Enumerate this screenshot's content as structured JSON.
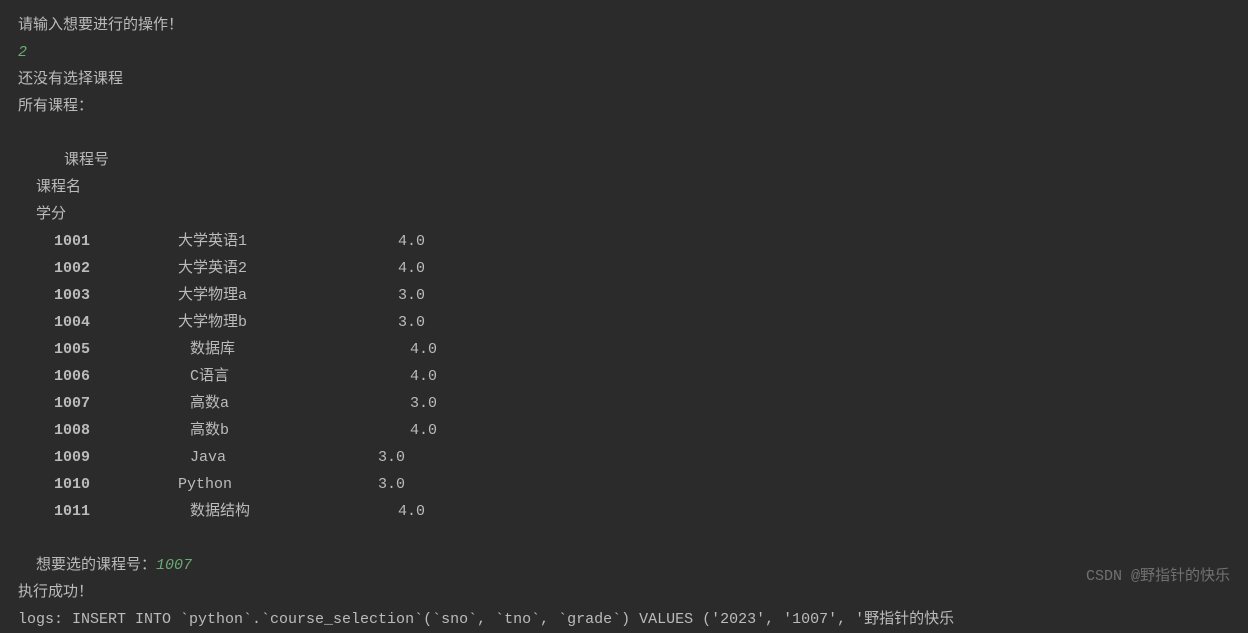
{
  "prompt_operation": "请输入想要进行的操作！",
  "operation_input": "2",
  "no_selection": "还没有选择课程",
  "all_courses_label": "所有课程：",
  "headers": {
    "course_id": "课程号",
    "course_name": "课程名",
    "credit": "学分"
  },
  "courses": [
    {
      "id": "1001",
      "name": "大学英语1",
      "credit": "4.0",
      "indent_name": 0,
      "indent_credit": 0
    },
    {
      "id": "1002",
      "name": "大学英语2",
      "credit": "4.0",
      "indent_name": 0,
      "indent_credit": 0
    },
    {
      "id": "1003",
      "name": "大学物理a",
      "credit": "3.0",
      "indent_name": 0,
      "indent_credit": 0
    },
    {
      "id": "1004",
      "name": "大学物理b",
      "credit": "3.0",
      "indent_name": 0,
      "indent_credit": 0
    },
    {
      "id": "1005",
      "name": "数据库",
      "credit": "4.0",
      "indent_name": 1,
      "indent_credit": 1
    },
    {
      "id": "1006",
      "name": "C语言",
      "credit": "4.0",
      "indent_name": 1,
      "indent_credit": 1
    },
    {
      "id": "1007",
      "name": "高数a",
      "credit": "3.0",
      "indent_name": 1,
      "indent_credit": 1
    },
    {
      "id": "1008",
      "name": "高数b",
      "credit": "4.0",
      "indent_name": 1,
      "indent_credit": 1
    },
    {
      "id": "1009",
      "name": "Java",
      "credit": "3.0",
      "indent_name": 1,
      "indent_credit": -3
    },
    {
      "id": "1010",
      "name": "Python",
      "credit": "3.0",
      "indent_name": 0,
      "indent_credit": -3
    },
    {
      "id": "1011",
      "name": "数据结构",
      "credit": "4.0",
      "indent_name": 1,
      "indent_credit": 0
    }
  ],
  "select_prompt": "想要选的课程号：",
  "select_input": "1007",
  "success_msg": "执行成功！",
  "log_line": "logs: INSERT INTO `python`.`course_selection`(`sno`, `tno`, `grade`) VALUES ('2023', '1007', '野指针的快乐",
  "watermark": "CSDN @野指针的快乐"
}
